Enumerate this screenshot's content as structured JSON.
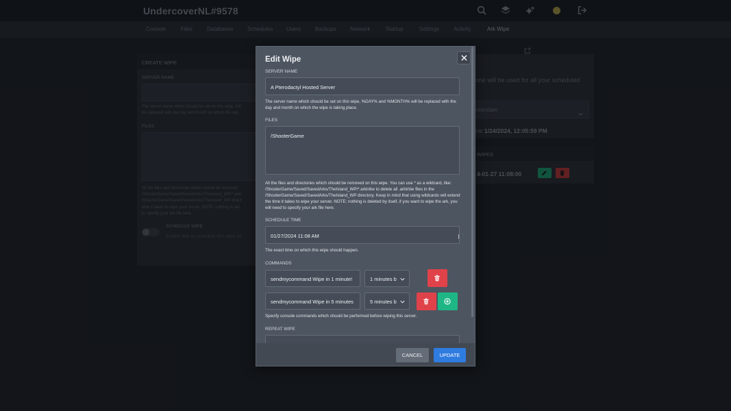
{
  "header": {
    "server_title": "UndercoverNL#9578",
    "icons": [
      "search-icon",
      "layers-icon",
      "cogs-icon",
      "avatar",
      "sign-out-icon"
    ]
  },
  "nav": {
    "tabs": [
      "Console",
      "Files",
      "Databases",
      "Schedules",
      "Users",
      "Backups",
      "Network",
      "Startup",
      "Settings",
      "Activity",
      "Ark Wipe"
    ],
    "active_tab": "Ark Wipe",
    "edit_icon": "external-edit-icon"
  },
  "background": {
    "create_wipe": {
      "title": "CREATE WIPE",
      "server_name_label": "SERVER NAME",
      "server_name_help": [
        "The server name which should be set on this wipe, %C",
        "be replaced with the day and month on which the wip"
      ],
      "files_label": "FILES",
      "files_help": [
        "All the files and directories which should be removed",
        "/ShooterGame/Saved/SavedArks/TheIsland_WP/*.arkt",
        "/ShooterGame/Saved/SavedArks/TheIsland_WP direct",
        "time it takes to wipe your server. NOTE: nothing is del",
        "to specify your ark file here."
      ],
      "schedule_label": "SCHEDULE WIPE",
      "schedule_help": "Enable this to schedule this wipe on"
    },
    "timezone": {
      "text": "one will be used for all your scheduled",
      "select_value": "nsterdam",
      "time_prefix": "ne: ",
      "time_value": "1/24/2024, 12:05:59 PM"
    },
    "wipes": {
      "title": "WIPES",
      "row_text": "4-01-27 11:08:00"
    }
  },
  "modal": {
    "title": "Edit Wipe",
    "close_icon": "close-icon",
    "server_name": {
      "label": "SERVER NAME",
      "value": "A Pterodactyl Hosted Server",
      "help": "The server name which should be set on this wipe, %DAY% and %MONTH% will be replaced with the day and month on which the wipe is taking place."
    },
    "files": {
      "label": "FILES",
      "value": "/ShooterGame",
      "help": "All the files and directories which should be removed on this wipe. You can use * as a wildcard, like: /ShooterGame/Saved/SavedArks/TheIsland_WP/*.arktribe to delete all .arktribe files in the /ShooterGame/Saved/SavedArks/TheIsland_WP directory. Keep in mind that using wildcards will extend the time it takes to wipe your server. NOTE: nothing is deleted by itself, if you want to wipe the ark, you will need to specify your ark file here."
    },
    "schedule_time": {
      "label": "SCHEDULE TIME",
      "value": "01/27/2024 11:08 AM",
      "help": "The exact time on which this wipe should happen."
    },
    "commands": {
      "label": "COMMANDS",
      "rows": [
        {
          "command": "sendmycommand Wipe in 1 minute!",
          "timing": "1 minutes b"
        },
        {
          "command": "sendmycommand Wipe in 5 minutes",
          "timing": "5 minutes b"
        }
      ],
      "help": "Specify console commands which should be performed before wiping this server."
    },
    "repeat_wipe": {
      "label": "REPEAT WIPE"
    },
    "cancel_label": "Cancel",
    "update_label": "Update"
  }
}
